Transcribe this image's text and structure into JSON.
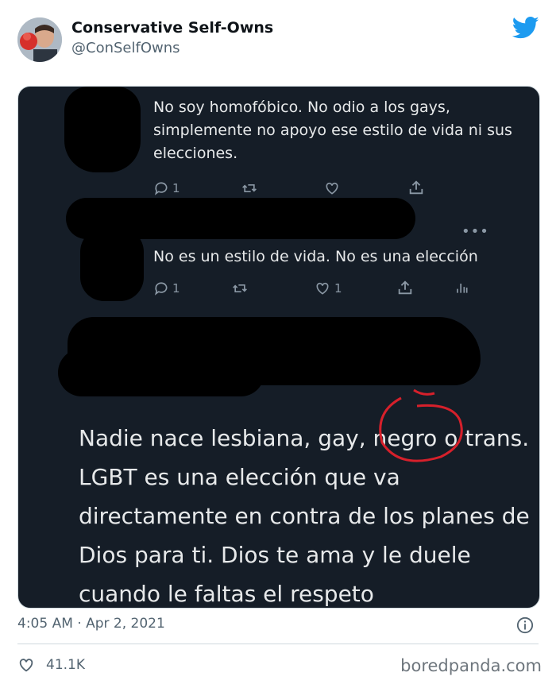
{
  "author": {
    "name": "Conservative Self-Owns",
    "handle": "@ConSelfOwns"
  },
  "embedded": {
    "reply1": {
      "text": "No soy homofóbico. No odio a los gays, simplemente no apoyo ese estilo de vida ni sus elecciones.",
      "reply_count": "1"
    },
    "reply2": {
      "text": "No es un estilo de vida. No es una elección",
      "reply_count": "1",
      "like_count": "1"
    },
    "main_text": "Nadie nace lesbiana, gay, negro o trans. LGBT es una elección que va directamente en contra de los planes de Dios para ti. Dios te ama y le duele cuando le faltas el respeto"
  },
  "tweet": {
    "timestamp": "4:05 AM · Apr 2, 2021",
    "likes": "41.1K"
  },
  "watermark": "boredpanda.com",
  "icons": {
    "brand": "twitter-bird-icon",
    "reply": "reply-icon",
    "retweet": "retweet-icon",
    "like": "heart-icon",
    "share": "share-icon",
    "analytics": "analytics-icon",
    "info": "info-icon"
  },
  "colors": {
    "twitter_blue": "#1d9bf0",
    "screenshot_bg": "#151d27",
    "circle_mark": "#d6202b"
  }
}
